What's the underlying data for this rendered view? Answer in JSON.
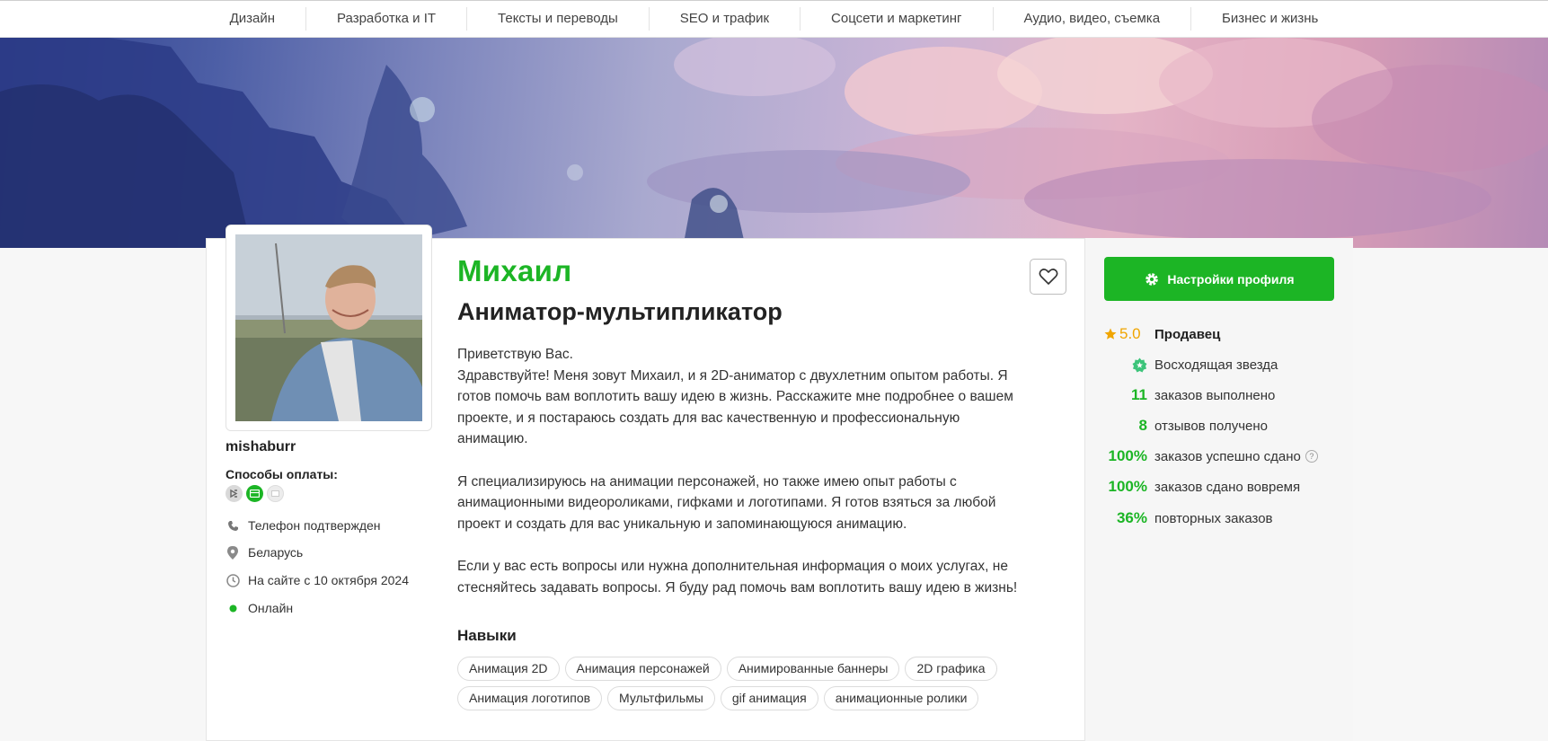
{
  "nav": {
    "items": [
      "Дизайн",
      "Разработка и IT",
      "Тексты и переводы",
      "SEO и трафик",
      "Соцсети и маркетинг",
      "Аудио, видео, съемка",
      "Бизнес и жизнь"
    ]
  },
  "profile": {
    "name": "Михаил",
    "title": "Аниматор-мультипликатор",
    "username": "mishaburr",
    "payment_title": "Способы оплаты:",
    "phone": "Телефон подтвержден",
    "country": "Беларусь",
    "since": "На сайте с 10 октября 2024",
    "status": "Онлайн"
  },
  "description": {
    "lines": [
      "Приветствую Вас.",
      "Здравствуйте! Меня зовут Михаил, и я 2D-аниматор с двухлетним опытом работы. Я",
      "готов помочь вам воплотить вашу идею в жизнь. Расскажите мне подробнее о вашем",
      "проекте, и я постараюсь создать для вас качественную и профессиональную",
      "анимацию."
    ],
    "lines2": [
      "Я специализируюсь на анимации персонажей, но также имею опыт работы с",
      "анимационными видеороликами, гифками и логотипами. Я готов взяться за любой",
      "проект и создать для вас уникальную и запоминающуюся анимацию."
    ],
    "lines3": [
      "Если у вас есть вопросы или нужна дополнительная информация о моих услугах, не",
      "стесняйтесь задавать вопросы. Я буду рад помочь вам воплотить вашу идею в жизнь!"
    ]
  },
  "skills": {
    "title": "Навыки",
    "items": [
      "Анимация 2D",
      "Анимация персонажей",
      "Анимированные баннеры",
      "2D графика",
      "Анимация логотипов",
      "Мультфильмы",
      "gif анимация",
      "анимационные ролики"
    ]
  },
  "sidebar": {
    "settings_label": "Настройки профиля",
    "rating": "5.0",
    "role": "Продавец",
    "badge": "Восходящая звезда",
    "stats": [
      {
        "value": "11",
        "label": "заказов выполнено"
      },
      {
        "value": "8",
        "label": "отзывов получено"
      },
      {
        "value": "100%",
        "label": "заказов успешно сдано"
      },
      {
        "value": "100%",
        "label": "заказов сдано вовремя"
      },
      {
        "value": "36%",
        "label": "повторных заказов"
      }
    ]
  },
  "colors": {
    "accent": "#1cb525",
    "rating": "#f0a500"
  }
}
